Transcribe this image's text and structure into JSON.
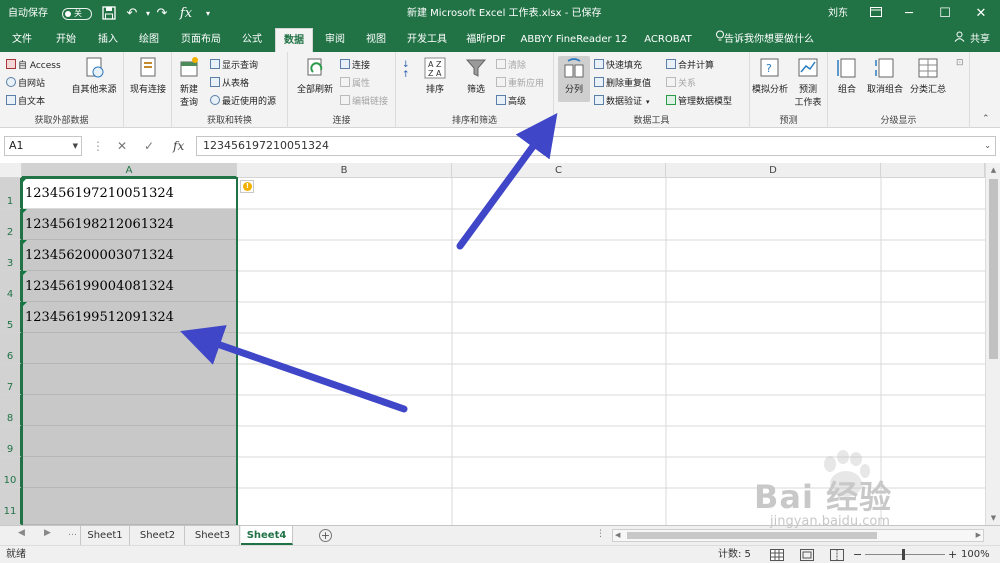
{
  "titlebar": {
    "autosave_label": "自动保存",
    "autosave_state": "关",
    "title": "新建 Microsoft Excel 工作表.xlsx - 已保存",
    "user": "刘东"
  },
  "tabs": [
    "文件",
    "开始",
    "插入",
    "绘图",
    "页面布局",
    "公式",
    "数据",
    "审阅",
    "视图",
    "开发工具",
    "福昕PDF",
    "ABBYY FineReader 12",
    "ACROBAT"
  ],
  "tell_me": "告诉我你想要做什么",
  "share_label": "共享",
  "ribbon": {
    "get_external": {
      "label": "获取外部数据",
      "access": "自 Access",
      "web": "自网站",
      "text": "自文本",
      "other_sources": "自其他来源",
      "existing": "现有连接"
    },
    "get_transform": {
      "label": "获取和转换",
      "new_query": "新建",
      "new_query2": "查询",
      "show_queries": "显示查询",
      "from_table": "从表格",
      "recent_sources": "最近使用的源"
    },
    "connections": {
      "label": "连接",
      "refresh_all": "全部刷新",
      "connections": "连接",
      "properties": "属性",
      "edit_links": "编辑链接"
    },
    "sort_filter": {
      "label": "排序和筛选",
      "sort": "排序",
      "filter": "筛选",
      "clear": "清除",
      "reapply": "重新应用",
      "advanced": "高级"
    },
    "data_tools": {
      "label": "数据工具",
      "text_to_columns": "分列",
      "flash_fill": "快速填充",
      "remove_duplicates": "删除重复值",
      "data_validation": "数据验证",
      "consolidate": "合并计算",
      "relationships": "关系",
      "manage_model": "管理数据模型"
    },
    "forecast": {
      "label": "预测",
      "what_if": "模拟分析",
      "forecast_sheet": "预测",
      "forecast_sheet2": "工作表"
    },
    "outline": {
      "label": "分级显示",
      "group": "组合",
      "ungroup": "取消组合",
      "subtotal": "分类汇总"
    }
  },
  "formula_bar": {
    "name_box": "A1",
    "cancel": "✕",
    "enter": "✓",
    "fx": "fx",
    "value": "123456197210051324"
  },
  "columns": [
    "A",
    "B",
    "C",
    "D"
  ],
  "rows": [
    "1",
    "2",
    "3",
    "4",
    "5",
    "6",
    "7",
    "8",
    "9",
    "10",
    "11"
  ],
  "cells_a": [
    "123456197210051324",
    "123456198212061324",
    "123456200003071324",
    "123456199004081324",
    "123456199512091324"
  ],
  "sheets": [
    "Sheet1",
    "Sheet2",
    "Sheet3",
    "Sheet4"
  ],
  "active_sheet": "Sheet4",
  "status": {
    "ready": "就绪",
    "count": "计数: 5",
    "zoom": "100%"
  },
  "watermark": {
    "brand": "Bai 经验",
    "url": "jingyan.baidu.com"
  },
  "colors": {
    "excel_green": "#217346",
    "annotation_arrow": "#3f46c8"
  }
}
